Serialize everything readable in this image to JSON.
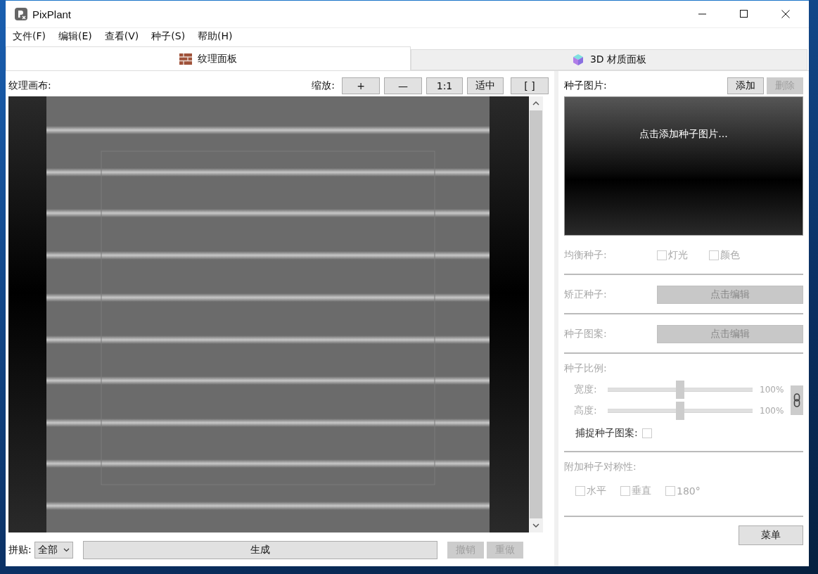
{
  "window": {
    "title": "PixPlant"
  },
  "menu": [
    {
      "label": "文件(F)"
    },
    {
      "label": "编辑(E)"
    },
    {
      "label": "查看(V)"
    },
    {
      "label": "种子(S)"
    },
    {
      "label": "帮助(H)"
    }
  ],
  "tabs": [
    {
      "label": "纹理面板",
      "selected": true
    },
    {
      "label": "3D 材质面板",
      "selected": false
    }
  ],
  "canvas": {
    "label": "纹理画布:",
    "zoom_label": "缩放:",
    "zoom_buttons": [
      "+",
      "—",
      "1:1",
      "适中",
      "[ ]"
    ]
  },
  "bottom": {
    "tile_label": "拼贴:",
    "tile_value": "全部",
    "generate": "生成",
    "actions": [
      {
        "label": "撤销",
        "disabled": true
      },
      {
        "label": "重做",
        "disabled": true
      }
    ]
  },
  "seed": {
    "label": "种子图片:",
    "buttons": [
      {
        "label": "添加",
        "disabled": false
      },
      {
        "label": "删除",
        "disabled": true
      }
    ],
    "hint": "点击添加种子图片..."
  },
  "settings": {
    "disabled": true,
    "balance": {
      "label": "均衡种子:",
      "options": [
        {
          "label": "灯光",
          "checked": false
        },
        {
          "label": "颜色",
          "checked": false
        }
      ]
    },
    "correct": {
      "label": "矫正种子:",
      "button": "点击编辑"
    },
    "pattern": {
      "label": "种子图案:",
      "button": "点击编辑"
    },
    "scale": {
      "label": "种子比例:",
      "sliders": [
        {
          "label": "宽度:",
          "level": 0.5,
          "reading": "100%"
        },
        {
          "label": "高度:",
          "level": 0.5,
          "reading": "100%"
        }
      ],
      "capture": {
        "label": "捕捉种子图案:",
        "checked": false
      }
    },
    "symmetry": {
      "label": "附加种子对称性:",
      "options": [
        {
          "label": "水平",
          "checked": false
        },
        {
          "label": "垂直",
          "checked": false
        },
        {
          "label": "180°",
          "checked": false
        }
      ]
    }
  },
  "menu_button": "菜单"
}
